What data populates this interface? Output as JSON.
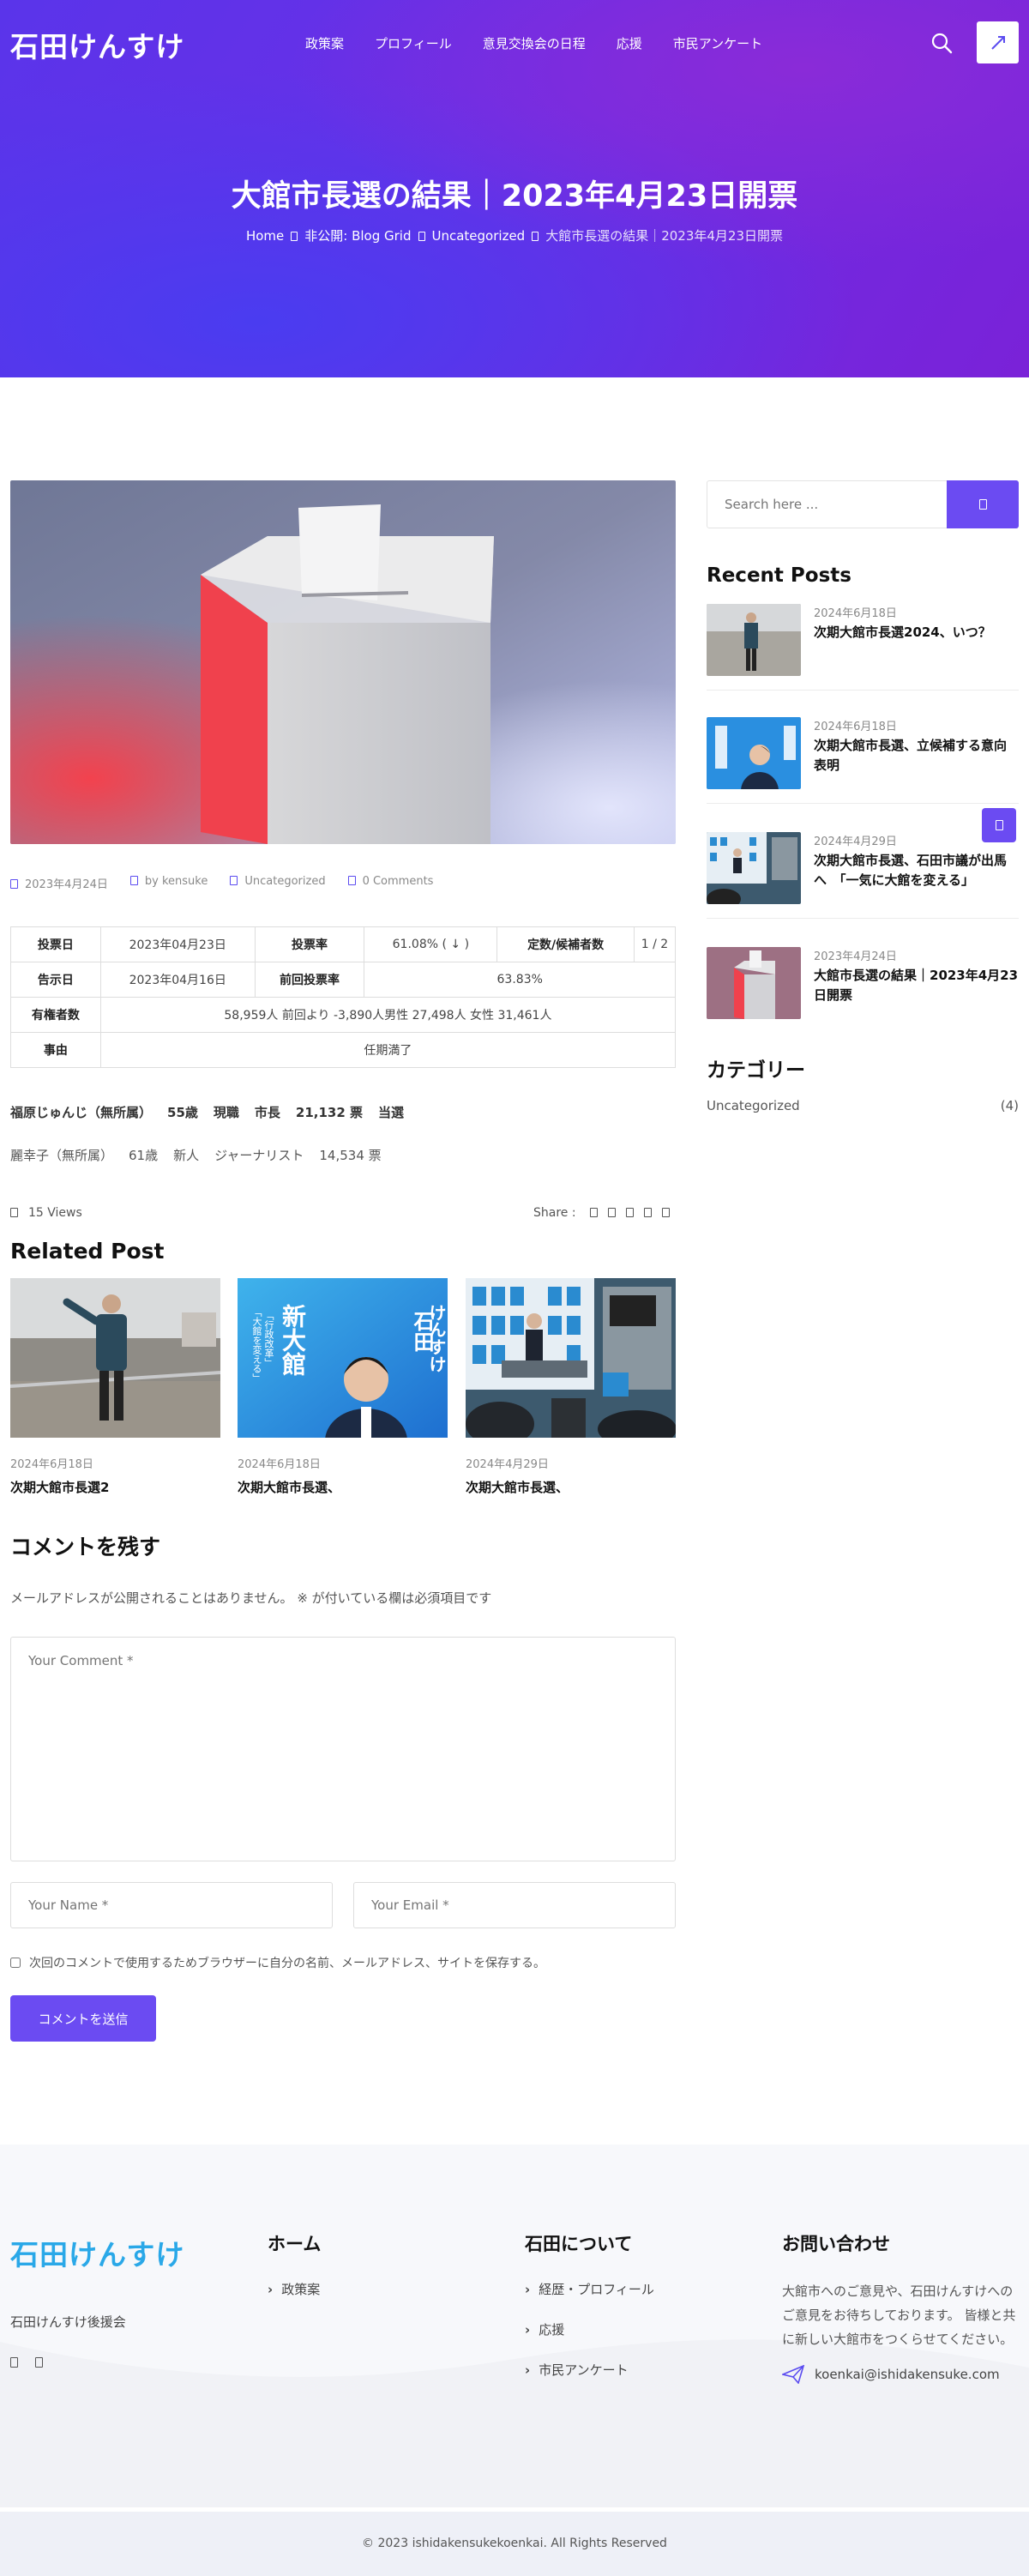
{
  "site": {
    "logo": "石田けんすけ",
    "nav": [
      "政策案",
      "プロフィール",
      "意見交換会の日程",
      "応援",
      "市民アンケート"
    ]
  },
  "hero": {
    "title": "大館市長選の結果｜2023年4月23日開票",
    "breadcrumb": [
      "Home",
      "非公開: Blog Grid",
      "Uncategorized",
      "大館市長選の結果｜2023年4月23日開票"
    ]
  },
  "post": {
    "meta": {
      "date": "2023年4月24日",
      "author": "by kensuke",
      "category": "Uncategorized",
      "comments": "0 Comments"
    },
    "table": {
      "row1": [
        "投票日",
        "2023年04月23日",
        "投票率",
        "61.08% ( ↓ )",
        "定数/候補者数",
        "1 / 2"
      ],
      "row2": [
        "告示日",
        "2023年04月16日",
        "前回投票率",
        "63.83%"
      ],
      "row3": [
        "有権者数",
        "58,959人 前回より -3,890人男性 27,498人 女性 31,461人"
      ],
      "row4": [
        "事由",
        "任期満了"
      ]
    },
    "candidate1": [
      "福原じゅんじ（無所属）",
      "55歳",
      "現職",
      "市長",
      "21,132 票",
      "当選"
    ],
    "candidate2": [
      "麗幸子（無所属）",
      "61歳",
      "新人",
      "ジャーナリスト",
      "14,534 票"
    ],
    "views": "15 Views",
    "share_label": "Share :"
  },
  "related": {
    "heading": "Related Post",
    "items": [
      {
        "date": "2024年6月18日",
        "title": "次期大館市長選2"
      },
      {
        "date": "2024年6月18日",
        "title": "次期大館市長選、"
      },
      {
        "date": "2024年4月29日",
        "title": "次期大館市長選、"
      }
    ],
    "poster": {
      "line1": "石田",
      "line2": "けんすけ",
      "big": "新大館",
      "sub": "「大館を変える」",
      "sub2": "「行政改革」"
    }
  },
  "comment": {
    "heading": "コメントを残す",
    "note": "メールアドレスが公開されることはありません。 ※ が付いている欄は必須項目です",
    "comment_placeholder": "Your Comment *",
    "name_placeholder": "Your Name *",
    "email_placeholder": "Your Email *",
    "save_label": "次回のコメントで使用するためブラウザーに自分の名前、メールアドレス、サイトを保存する。",
    "submit_label": "コメントを送信"
  },
  "sidebar": {
    "search_placeholder": "Search here ...",
    "recent_heading": "Recent Posts",
    "recent": [
      {
        "date": "2024年6月18日",
        "title": "次期大館市長選2024、いつ？"
      },
      {
        "date": "2024年6月18日",
        "title": "次期大館市長選、立候補する意向表明"
      },
      {
        "date": "2024年4月29日",
        "title": "次期大館市長選、石田市議が出馬へ　「一気に大館を変える」"
      },
      {
        "date": "2023年4月24日",
        "title": "大館市長選の結果｜2023年4月23日開票"
      }
    ],
    "category_heading": "カテゴリー",
    "categories": [
      {
        "name": "Uncategorized",
        "count": "(4)"
      }
    ]
  },
  "footer": {
    "logo": "石田けんすけ",
    "org": "石田けんすけ後援会",
    "home_heading": "ホーム",
    "home_links": [
      "政策案"
    ],
    "about_heading": "石田について",
    "about_links": [
      "経歴・プロフィール",
      "応援",
      "市民アンケート"
    ],
    "contact_heading": "お問い合わせ",
    "contact_text": "大館市へのご意見や、石田けんすけへのご意見をお待ちしております。 皆様と共に新しい大館市をつくらせてください。",
    "email": "koenkai@ishidakensuke.com",
    "copyright": "© 2023 ishidakensukekoenkai. All Rights Reserved"
  },
  "colors": {
    "accent": "#6b4bf2",
    "hero_start": "#5a34ea",
    "hero_end": "#7a22d8",
    "logo_blue": "#2aa8e8"
  }
}
